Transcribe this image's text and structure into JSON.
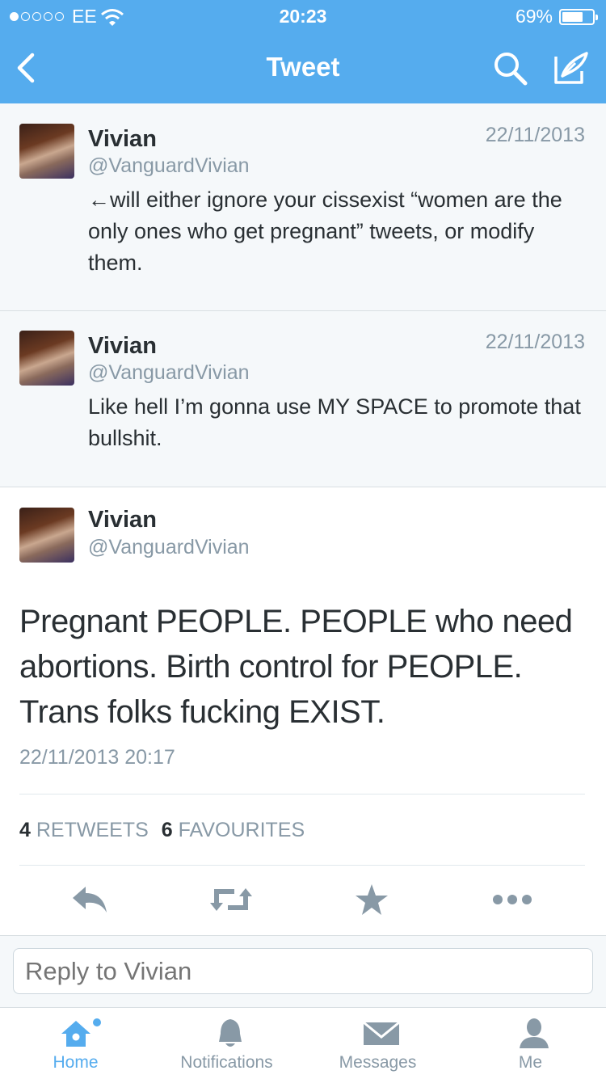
{
  "status_bar": {
    "carrier": "EE",
    "time": "20:23",
    "battery": "69%",
    "battery_level": 0.69
  },
  "nav": {
    "title": "Tweet",
    "icons": [
      "back-icon",
      "search-icon",
      "compose-icon"
    ]
  },
  "tweets": [
    {
      "name": "Vivian",
      "handle": "@VanguardVivian",
      "date": "22/11/2013",
      "text": "←will either ignore your cissexist “women are the only ones who get pregnant” tweets, or modify them."
    },
    {
      "name": "Vivian",
      "handle": "@VanguardVivian",
      "date": "22/11/2013",
      "text": "Like hell I’m gonna use MY SPACE to promote that bullshit."
    }
  ],
  "main_tweet": {
    "name": "Vivian",
    "handle": "@VanguardVivian",
    "text": "Pregnant PEOPLE. PEOPLE who need abortions. Birth control for PEOPLE. Trans folks fucking EXIST.",
    "timestamp": "22/11/2013 20:17",
    "retweets_count": "4",
    "retweets_label": "RETWEETS",
    "favourites_count": "6",
    "favourites_label": "FAVOURITES"
  },
  "reply": {
    "placeholder": "Reply to Vivian"
  },
  "tabbar": [
    {
      "label": "Home",
      "icon": "home-icon",
      "active": true
    },
    {
      "label": "Notifications",
      "icon": "bell-icon",
      "active": false
    },
    {
      "label": "Messages",
      "icon": "envelope-icon",
      "active": false
    },
    {
      "label": "Me",
      "icon": "person-icon",
      "active": false
    }
  ],
  "colors": {
    "accent": "#55acee",
    "muted": "#8899a6",
    "text": "#292f33",
    "icon": "#8899a6"
  }
}
